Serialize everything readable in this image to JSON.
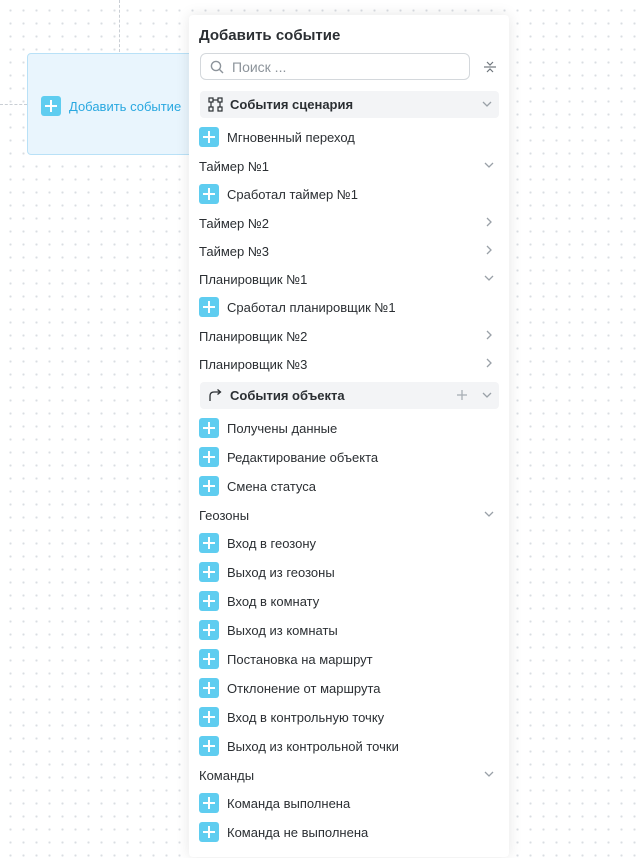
{
  "canvas": {
    "node": {
      "label": "Добавить событие"
    }
  },
  "panel": {
    "title": "Добавить событие",
    "search": {
      "placeholder": "Поиск ..."
    },
    "sections": [
      {
        "label": "События сценария",
        "icon": "scenario-graph-icon",
        "expanded": true
      },
      {
        "label": "События объекта",
        "icon": "object-arrow-icon",
        "expanded": true
      }
    ],
    "scenario": {
      "instant": "Мгновенный переход",
      "timer1": "Таймер №1",
      "timer1_fired": "Сработал таймер №1",
      "timer2": "Таймер №2",
      "timer3": "Таймер №3",
      "planner1": "Планировщик №1",
      "planner1_fired": "Сработал планировщик №1",
      "planner2": "Планировщик №2",
      "planner3": "Планировщик №3"
    },
    "object": {
      "data_received": "Получены данные",
      "object_edit": "Редактирование объекта",
      "status_change": "Смена статуса",
      "geozones": "Геозоны",
      "geozone_items": [
        "Вход в геозону",
        "Выход из геозоны",
        "Вход в комнату",
        "Выход из комнаты",
        "Постановка на маршрут",
        "Отклонение от маршрута",
        "Вход в контрольную точку",
        "Выход из контрольной точки"
      ],
      "commands": "Команды",
      "command_items": [
        "Команда выполнена",
        "Команда не выполнена"
      ]
    }
  },
  "colors": {
    "accent": "#5fcdf0",
    "node_bg": "#e9f5fd",
    "node_text": "#29a8e0",
    "section_bg": "#f3f4f6"
  }
}
